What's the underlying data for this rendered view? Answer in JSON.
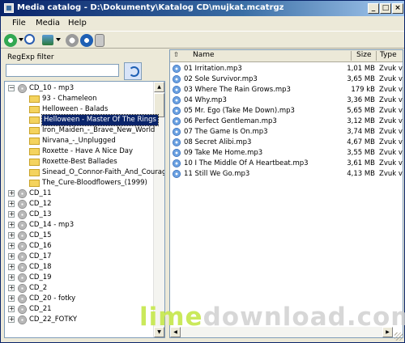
{
  "window": {
    "title": "Media catalog - D:\\Dokumenty\\Katalog CD\\mujkat.mcatrgz"
  },
  "menu": [
    "File",
    "Media",
    "Help"
  ],
  "filter": {
    "label": "RegExp filter",
    "value": ""
  },
  "tree": [
    {
      "label": "CD_10 - mp3",
      "kind": "cd",
      "expanded": true,
      "depth": 0
    },
    {
      "label": "93 - Chameleon",
      "kind": "folder",
      "depth": 1
    },
    {
      "label": "Helloween - Balads",
      "kind": "folder",
      "depth": 1
    },
    {
      "label": "Helloween - Master Of The Rings",
      "kind": "folder",
      "depth": 1,
      "selected": true
    },
    {
      "label": "Iron_Maiden_-_Brave_New_World",
      "kind": "folder",
      "depth": 1
    },
    {
      "label": "Nirvana_-_Unplugged",
      "kind": "folder",
      "depth": 1
    },
    {
      "label": "Roxette - Have A Nice Day",
      "kind": "folder",
      "depth": 1
    },
    {
      "label": "Roxette-Best Ballades",
      "kind": "folder",
      "depth": 1
    },
    {
      "label": "Sinead_O_Connor-Faith_And_Courage",
      "kind": "folder",
      "depth": 1
    },
    {
      "label": "The_Cure-Bloodflowers_(1999)",
      "kind": "folder",
      "depth": 1
    },
    {
      "label": "CD_11",
      "kind": "cd",
      "depth": 0
    },
    {
      "label": "CD_12",
      "kind": "cd",
      "depth": 0
    },
    {
      "label": "CD_13",
      "kind": "cd",
      "depth": 0
    },
    {
      "label": "CD_14 - mp3",
      "kind": "cd",
      "depth": 0
    },
    {
      "label": "CD_15",
      "kind": "cd",
      "depth": 0
    },
    {
      "label": "CD_16",
      "kind": "cd",
      "depth": 0
    },
    {
      "label": "CD_17",
      "kind": "cd",
      "depth": 0
    },
    {
      "label": "CD_18",
      "kind": "cd",
      "depth": 0
    },
    {
      "label": "CD_19",
      "kind": "cd",
      "depth": 0
    },
    {
      "label": "CD_2",
      "kind": "cd",
      "depth": 0
    },
    {
      "label": "CD_20 - fotky",
      "kind": "cd",
      "depth": 0
    },
    {
      "label": "CD_21",
      "kind": "cd",
      "depth": 0
    },
    {
      "label": "CD_22_FOTKY",
      "kind": "cd",
      "depth": 0
    }
  ],
  "list": {
    "columns": {
      "name": "Name",
      "size": "Size",
      "type": "Type"
    },
    "rows": [
      {
        "name": "01 Irritation.mp3",
        "size": "1,01 MB",
        "type": "Zvuk v..."
      },
      {
        "name": "02 Sole Survivor.mp3",
        "size": "3,65 MB",
        "type": "Zvuk v..."
      },
      {
        "name": "03 Where The Rain Grows.mp3",
        "size": "179 kB",
        "type": "Zvuk v..."
      },
      {
        "name": "04 Why.mp3",
        "size": "3,36 MB",
        "type": "Zvuk v..."
      },
      {
        "name": "05 Mr. Ego (Take Me Down).mp3",
        "size": "5,65 MB",
        "type": "Zvuk v..."
      },
      {
        "name": "06 Perfect Gentleman.mp3",
        "size": "3,12 MB",
        "type": "Zvuk v..."
      },
      {
        "name": "07 The Game Is On.mp3",
        "size": "3,74 MB",
        "type": "Zvuk v..."
      },
      {
        "name": "08 Secret Alibi.mp3",
        "size": "4,67 MB",
        "type": "Zvuk v..."
      },
      {
        "name": "09 Take Me Home.mp3",
        "size": "3,55 MB",
        "type": "Zvuk v..."
      },
      {
        "name": "10 I The Middle Of A Heartbeat.mp3",
        "size": "3,61 MB",
        "type": "Zvuk v..."
      },
      {
        "name": "11 Still We Go.mp3",
        "size": "4,13 MB",
        "type": "Zvuk v..."
      }
    ]
  },
  "watermark": {
    "part1": "lime",
    "part2": "download.com"
  },
  "colors": {
    "selection": "#0a246a",
    "titlebar": "#0a246a"
  }
}
